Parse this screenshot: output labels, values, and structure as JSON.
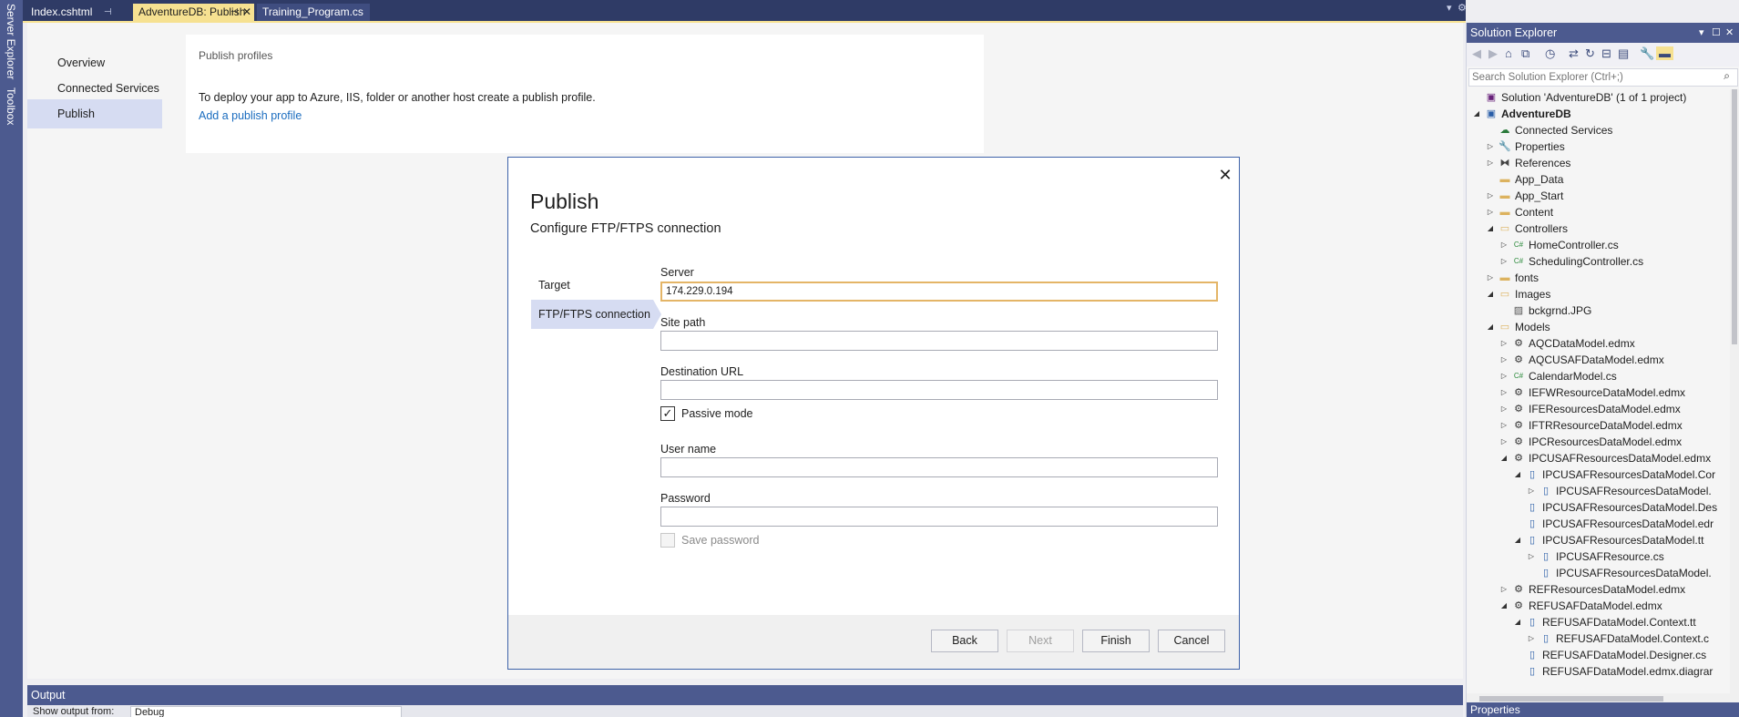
{
  "left_strip": {
    "server_explorer": "Server Explorer",
    "toolbox": "Toolbox"
  },
  "tabs": [
    {
      "label": "Index.cshtml",
      "icon": "pin-icon"
    },
    {
      "label": "AdventureDB: Publish",
      "icon": "pin-icon",
      "active": true
    },
    {
      "label": "Training_Program.cs"
    }
  ],
  "nav": [
    "Overview",
    "Connected Services",
    "Publish"
  ],
  "profiles": {
    "heading": "Publish profiles",
    "description": "To deploy your app to Azure, IIS, folder or another host create a publish profile.",
    "link": "Add a publish profile"
  },
  "dialog": {
    "title": "Publish",
    "subtitle": "Configure FTP/FTPS connection",
    "steps": [
      "Target",
      "FTP/FTPS connection"
    ],
    "server_label": "Server",
    "server_value": "174.229.0.194",
    "site_path_label": "Site path",
    "site_path_value": "",
    "destination_url_label": "Destination URL",
    "destination_url_value": "",
    "passive_mode_label": "Passive mode",
    "passive_mode_checked": true,
    "user_name_label": "User name",
    "user_name_value": "",
    "password_label": "Password",
    "password_value": "",
    "save_password_label": "Save password",
    "buttons": {
      "back": "Back",
      "next": "Next",
      "finish": "Finish",
      "cancel": "Cancel"
    }
  },
  "output": {
    "title": "Output",
    "show_from_label": "Show output from:",
    "show_from_value": "Debug"
  },
  "solution_explorer": {
    "title": "Solution Explorer",
    "search_placeholder": "Search Solution Explorer (Ctrl+;)",
    "tree": [
      {
        "label": "Solution 'AdventureDB' (1 of 1 project)",
        "icon": "solution-icon",
        "depth": 0,
        "toggle": ""
      },
      {
        "label": "AdventureDB",
        "icon": "project-icon",
        "depth": 0,
        "toggle": "open",
        "bold": true
      },
      {
        "label": "Connected Services",
        "icon": "cloud-icon",
        "depth": 1,
        "toggle": ""
      },
      {
        "label": "Properties",
        "icon": "wrench-icon",
        "depth": 1,
        "toggle": "closed"
      },
      {
        "label": "References",
        "icon": "references-icon",
        "depth": 1,
        "toggle": "closed"
      },
      {
        "label": "App_Data",
        "icon": "folder-icon",
        "depth": 1,
        "toggle": ""
      },
      {
        "label": "App_Start",
        "icon": "folder-icon",
        "depth": 1,
        "toggle": "closed"
      },
      {
        "label": "Content",
        "icon": "folder-icon",
        "depth": 1,
        "toggle": "closed"
      },
      {
        "label": "Controllers",
        "icon": "folder-open-icon",
        "depth": 1,
        "toggle": "open"
      },
      {
        "label": "HomeController.cs",
        "icon": "csharp-icon",
        "depth": 2,
        "toggle": "closed"
      },
      {
        "label": "SchedulingController.cs",
        "icon": "csharp-icon",
        "depth": 2,
        "toggle": "closed"
      },
      {
        "label": "fonts",
        "icon": "folder-icon",
        "depth": 1,
        "toggle": "closed"
      },
      {
        "label": "Images",
        "icon": "folder-open-icon",
        "depth": 1,
        "toggle": "open"
      },
      {
        "label": "bckgrnd.JPG",
        "icon": "image-icon",
        "depth": 2,
        "toggle": ""
      },
      {
        "label": "Models",
        "icon": "folder-open-icon",
        "depth": 1,
        "toggle": "open"
      },
      {
        "label": "AQCDataModel.edmx",
        "icon": "edmx-icon",
        "depth": 2,
        "toggle": "closed"
      },
      {
        "label": "AQCUSAFDataModel.edmx",
        "icon": "edmx-icon",
        "depth": 2,
        "toggle": "closed"
      },
      {
        "label": "CalendarModel.cs",
        "icon": "csharp-icon",
        "depth": 2,
        "toggle": "closed"
      },
      {
        "label": "IEFWResourceDataModel.edmx",
        "icon": "edmx-icon",
        "depth": 2,
        "toggle": "closed"
      },
      {
        "label": "IFEResourcesDataModel.edmx",
        "icon": "edmx-icon",
        "depth": 2,
        "toggle": "closed"
      },
      {
        "label": "IFTRResourceDataModel.edmx",
        "icon": "edmx-icon",
        "depth": 2,
        "toggle": "closed"
      },
      {
        "label": "IPCResourcesDataModel.edmx",
        "icon": "edmx-icon",
        "depth": 2,
        "toggle": "closed"
      },
      {
        "label": "IPCUSAFResourcesDataModel.edmx",
        "icon": "edmx-icon",
        "depth": 2,
        "toggle": "open"
      },
      {
        "label": "IPCUSAFResourcesDataModel.Cor",
        "icon": "file-icon",
        "depth": 3,
        "toggle": "open"
      },
      {
        "label": "IPCUSAFResourcesDataModel.",
        "icon": "file-icon",
        "depth": 4,
        "toggle": "closed"
      },
      {
        "label": "IPCUSAFResourcesDataModel.Des",
        "icon": "file-icon",
        "depth": 3,
        "toggle": ""
      },
      {
        "label": "IPCUSAFResourcesDataModel.edr",
        "icon": "file-icon",
        "depth": 3,
        "toggle": ""
      },
      {
        "label": "IPCUSAFResourcesDataModel.tt",
        "icon": "file-icon",
        "depth": 3,
        "toggle": "open"
      },
      {
        "label": "IPCUSAFResource.cs",
        "icon": "file-icon",
        "depth": 4,
        "toggle": "closed"
      },
      {
        "label": "IPCUSAFResourcesDataModel.",
        "icon": "file-icon",
        "depth": 4,
        "toggle": ""
      },
      {
        "label": "REFResourcesDataModel.edmx",
        "icon": "edmx-icon",
        "depth": 2,
        "toggle": "closed"
      },
      {
        "label": "REFUSAFDataModel.edmx",
        "icon": "edmx-icon",
        "depth": 2,
        "toggle": "open"
      },
      {
        "label": "REFUSAFDataModel.Context.tt",
        "icon": "file-icon",
        "depth": 3,
        "toggle": "open"
      },
      {
        "label": "REFUSAFDataModel.Context.c",
        "icon": "file-icon",
        "depth": 4,
        "toggle": "closed"
      },
      {
        "label": "REFUSAFDataModel.Designer.cs",
        "icon": "file-icon",
        "depth": 3,
        "toggle": ""
      },
      {
        "label": "REFUSAFDataModel.edmx.diagrar",
        "icon": "file-icon",
        "depth": 3,
        "toggle": ""
      }
    ],
    "properties_title": "Properties"
  },
  "colors": {
    "accent": "#4c5a8f",
    "tab_active": "#f6e191",
    "selection": "#d6dcf2",
    "focus_border": "#e4b567",
    "link": "#1a6cbf"
  }
}
